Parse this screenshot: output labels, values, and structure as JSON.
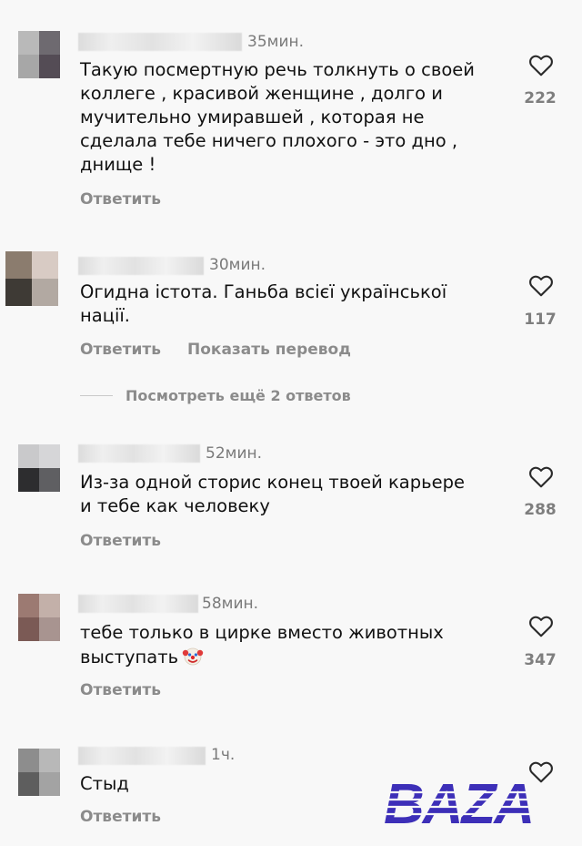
{
  "comments": [
    {
      "time": "35мин.",
      "text": "Такую посмертную речь толкнуть о своей\nколлеге , красивой женщине , долго и\nмучительно умиравшей , которая не\nсделала тебе ничего плохого - это дно ,\nднище !",
      "likes": "222",
      "reply": "Ответить",
      "avatar_colors": [
        "#b9b9b9",
        "#6e6a70",
        "#a7a7a7",
        "#544c55"
      ]
    },
    {
      "time": "30мин.",
      "text": "Огидна істота. Ганьба всієї української\nнації.",
      "likes": "117",
      "reply": "Ответить",
      "translate": "Показать перевод",
      "more_replies": "Посмотреть ещё 2 ответов",
      "avatar_colors": [
        "#8b7c6e",
        "#d8cbc4",
        "#3e3a35",
        "#b2a9a2"
      ]
    },
    {
      "time": "52мин.",
      "text": "Из-за одной сторис конец твоей карьере\nи тебе как человеку",
      "likes": "288",
      "reply": "Ответить",
      "avatar_colors": [
        "#2d2d2f",
        "#5f5f62",
        "#9a9a9c",
        "#c9c9cb"
      ]
    },
    {
      "time": "58мин.",
      "text": "тебе только в цирке вместо животных\nвыступать",
      "likes": "347",
      "reply": "Ответить",
      "avatar_colors": [
        "#9c7a72",
        "#c3b0a9",
        "#7b5a55",
        "#a89490"
      ]
    },
    {
      "time": "1ч.",
      "text": "Стыд",
      "likes": "",
      "reply": "Ответить",
      "avatar_colors": [
        "#8d8d8d",
        "#b8b8b8",
        "#5e5e5e",
        "#a3a3a3"
      ]
    }
  ],
  "watermark": {
    "text": "BAZA",
    "color": "#3d2fb8"
  },
  "icons": {
    "like": "heart-outline-icon",
    "emoji": "clown-face-icon"
  }
}
